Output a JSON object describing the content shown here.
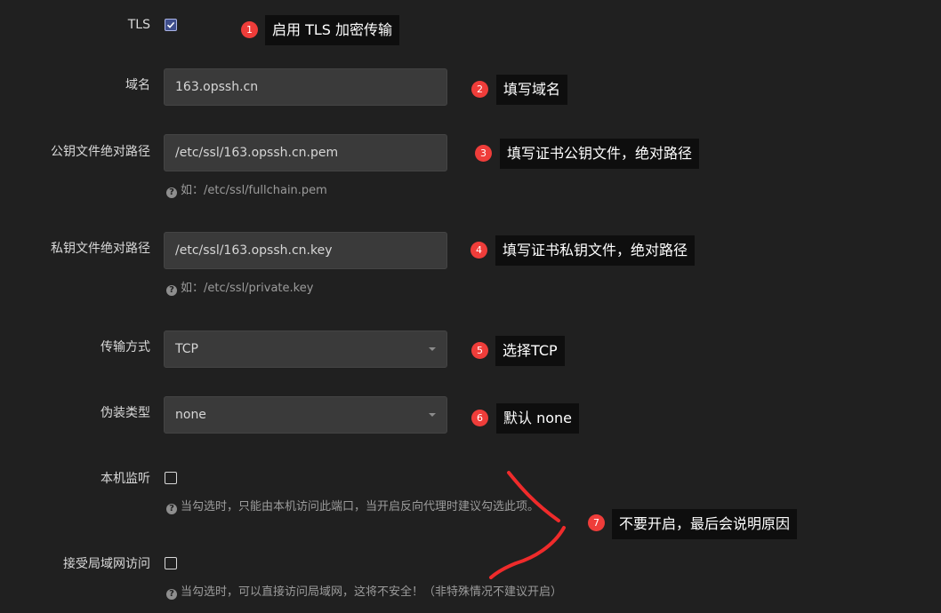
{
  "form": {
    "tls": {
      "label": "TLS",
      "checked": true
    },
    "domain": {
      "label": "域名",
      "value": "163.opssh.cn"
    },
    "cert_path": {
      "label": "公钥文件绝对路径",
      "value": "/etc/ssl/163.opssh.cn.pem",
      "help_prefix": "如：",
      "help_value": "/etc/ssl/fullchain.pem"
    },
    "key_path": {
      "label": "私钥文件绝对路径",
      "value": "/etc/ssl/163.opssh.cn.key",
      "help_prefix": "如：",
      "help_value": "/etc/ssl/private.key"
    },
    "transport": {
      "label": "传输方式",
      "value": "TCP"
    },
    "disguise": {
      "label": "伪装类型",
      "value": "none"
    },
    "local_listen": {
      "label": "本机监听",
      "checked": false,
      "help": "当勾选时，只能由本机访问此端口，当开启反向代理时建议勾选此项。"
    },
    "lan_access": {
      "label": "接受局域网访问",
      "checked": false,
      "help": "当勾选时，可以直接访问局域网，这将不安全！（非特殊情况不建议开启）"
    }
  },
  "annotations": [
    {
      "num": "1",
      "text": "启用 TLS 加密传输"
    },
    {
      "num": "2",
      "text": "填写域名"
    },
    {
      "num": "3",
      "text": "填写证书公钥文件，绝对路径"
    },
    {
      "num": "4",
      "text": "填写证书私钥文件，绝对路径"
    },
    {
      "num": "5",
      "text": "选择TCP"
    },
    {
      "num": "6",
      "text": "默认 none"
    },
    {
      "num": "7",
      "text": "不要开启，最后会说明原因"
    }
  ],
  "icons": {
    "help": "question-circle-icon",
    "checkbox_check": "check-icon",
    "select_caret": "caret-down-icon"
  },
  "colors": {
    "background": "#202020",
    "input_bg": "#3a3a3a",
    "badge": "#ef3d3a",
    "note_bg": "#0e0e0e",
    "arrow": "#ef2b2b",
    "checkbox_checked": "#3f4e8c"
  }
}
